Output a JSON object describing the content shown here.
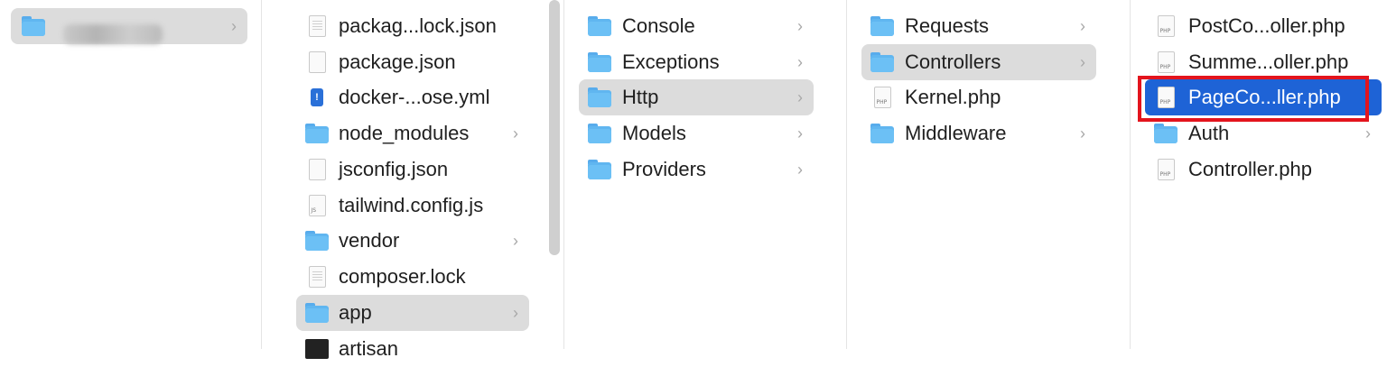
{
  "column1": {
    "items": [
      {
        "label": "",
        "icon": "folder-icon",
        "has_chevron": true,
        "selected": true
      }
    ]
  },
  "column2": {
    "items": [
      {
        "label": "packag...lock.json",
        "icon": "document-icon"
      },
      {
        "label": "package.json",
        "icon": "document-icon"
      },
      {
        "label": "docker-...ose.yml",
        "icon": "yaml-file-icon"
      },
      {
        "label": "node_modules",
        "icon": "folder-icon",
        "has_chevron": true
      },
      {
        "label": "jsconfig.json",
        "icon": "document-icon"
      },
      {
        "label": "tailwind.config.js",
        "icon": "js-file-icon"
      },
      {
        "label": "vendor",
        "icon": "folder-icon",
        "has_chevron": true
      },
      {
        "label": "composer.lock",
        "icon": "vscode-file-icon"
      },
      {
        "label": "app",
        "icon": "folder-icon",
        "has_chevron": true,
        "selected": true
      },
      {
        "label": "artisan",
        "icon": "terminal-file-icon"
      }
    ]
  },
  "column3": {
    "items": [
      {
        "label": "Console",
        "icon": "folder-icon",
        "has_chevron": true
      },
      {
        "label": "Exceptions",
        "icon": "folder-icon",
        "has_chevron": true
      },
      {
        "label": "Http",
        "icon": "folder-icon",
        "has_chevron": true,
        "selected": true
      },
      {
        "label": "Models",
        "icon": "folder-icon",
        "has_chevron": true
      },
      {
        "label": "Providers",
        "icon": "folder-icon",
        "has_chevron": true
      }
    ]
  },
  "column4": {
    "items": [
      {
        "label": "Requests",
        "icon": "folder-icon",
        "has_chevron": true
      },
      {
        "label": "Controllers",
        "icon": "folder-icon",
        "has_chevron": true,
        "selected": true
      },
      {
        "label": "Kernel.php",
        "icon": "php-file-icon"
      },
      {
        "label": "Middleware",
        "icon": "folder-icon",
        "has_chevron": true
      }
    ]
  },
  "column5": {
    "items": [
      {
        "label": "PostCo...oller.php",
        "icon": "php-file-icon"
      },
      {
        "label": "Summe...oller.php",
        "icon": "php-file-icon"
      },
      {
        "label": "PageCo...ller.php",
        "icon": "php-file-icon",
        "active": true,
        "highlighted": true
      },
      {
        "label": "Auth",
        "icon": "folder-icon",
        "has_chevron": true
      },
      {
        "label": "Controller.php",
        "icon": "php-file-icon"
      }
    ]
  },
  "file_tags": {
    "php": "PHP",
    "js": "JS",
    "yml": "!"
  },
  "chevron": "›",
  "colors": {
    "accent": "#1e63d6",
    "highlight_border": "#e3141d",
    "folder": "#60b6f0",
    "selection": "#dcdcdc"
  }
}
